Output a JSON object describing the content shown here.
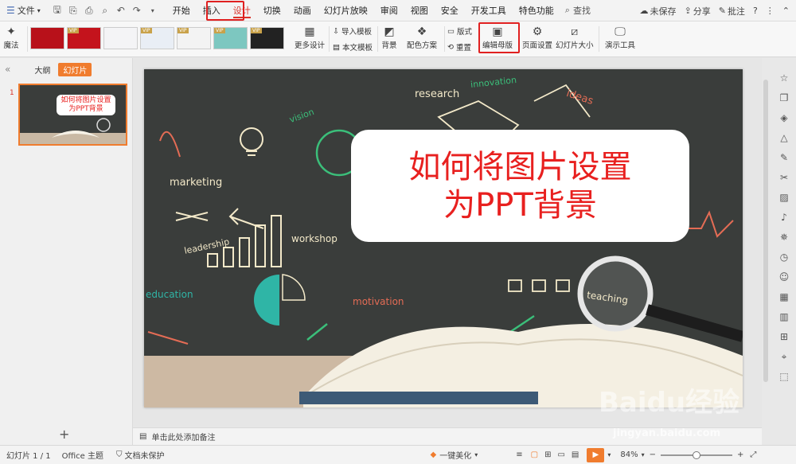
{
  "menubar": {
    "file_label": "文件",
    "tabs": [
      "开始",
      "插入",
      "设计",
      "切换",
      "动画",
      "幻灯片放映",
      "审阅",
      "视图",
      "安全",
      "开发工具",
      "特色功能"
    ],
    "active_tab": "设计",
    "search_label": "查找",
    "unsaved_label": "未保存",
    "share_label": "分享",
    "comment_label": "批注",
    "help_label": "?"
  },
  "ribbon": {
    "magic_label": "魔法",
    "vip_label": "VIP",
    "more_design_label": "更多设计",
    "import_template_label": "导入模板",
    "this_template_label": "本文模板",
    "background_label": "背景",
    "color_scheme_label": "配色方案",
    "layout_label": "版式",
    "reset_label": "重置",
    "edit_master_label": "编辑母版",
    "page_setup_label": "页面设置",
    "slide_size_label": "幻灯片大小",
    "presentation_tools_label": "演示工具"
  },
  "leftpane": {
    "outline_tab": "大纲",
    "slides_tab": "幻灯片",
    "slide_number": "1",
    "thumb_title_line1": "如何将图片设置",
    "thumb_title_line2": "为PPT背景"
  },
  "slide": {
    "title_line1": "如何将图片设置",
    "title_line2": "为PPT背景",
    "chalk_words": {
      "research": "research",
      "innovation": "innovation",
      "ideas": "ideas",
      "vision": "vision",
      "marketing": "marketing",
      "leadership": "leadership",
      "workshop": "workshop",
      "education": "education",
      "motivation": "motivation",
      "teaching": "teaching"
    }
  },
  "notes": {
    "placeholder": "单击此处添加备注"
  },
  "statusbar": {
    "slide_count": "幻灯片 1 / 1",
    "theme": "Office 主题",
    "protection": "文档未保护",
    "beautify": "一键美化",
    "zoom": "84%"
  },
  "watermark": {
    "brand": "Baidu经验",
    "url": "jingyan.baidu.com"
  },
  "colors": {
    "accent_red": "#d9342b",
    "title_red": "#e8201f",
    "accent_orange": "#f07c2e",
    "chalkboard": "#3a3d3b"
  }
}
